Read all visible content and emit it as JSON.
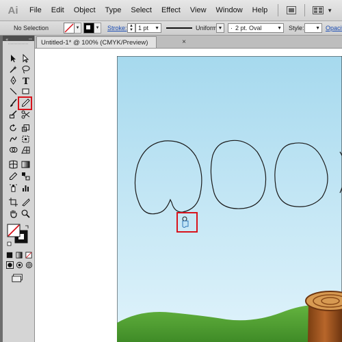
{
  "app": {
    "logo_text": "Ai",
    "menu": [
      "File",
      "Edit",
      "Object",
      "Type",
      "Select",
      "Effect",
      "View",
      "Window",
      "Help"
    ],
    "menu_icons": [
      "bridge-icon",
      "arrange-documents-icon"
    ]
  },
  "control_bar": {
    "selection_label": "No Selection",
    "stroke_label": "Stroke:",
    "stroke_weight": "1 pt",
    "stroke_profile": "Uniform",
    "brush_definition": "2 pt. Oval",
    "style_label": "Style:",
    "opacity_label": "Opacit"
  },
  "document": {
    "tab_title": "Untitled-1* @ 100% (CMYK/Preview)",
    "close_glyph": "×"
  },
  "toolbox": {
    "active_tool": "paintbrush-tool",
    "tools": [
      "selection-tool",
      "direct-selection-tool",
      "magic-wand-tool",
      "lasso-tool",
      "pen-tool",
      "type-tool",
      "line-segment-tool",
      "rectangle-tool",
      "paintbrush-tool",
      "pencil-tool",
      "blob-brush-tool",
      "eraser-tool",
      "rotate-tool",
      "scale-tool",
      "warp-tool",
      "free-transform-tool",
      "shape-builder-tool",
      "perspective-grid-tool",
      "mesh-tool",
      "gradient-tool",
      "eyedropper-tool",
      "blend-tool",
      "symbol-sprayer-tool",
      "column-graph-tool",
      "artboard-tool",
      "slice-tool",
      "hand-tool",
      "zoom-tool"
    ]
  },
  "colors": {
    "highlight": "#d8121b",
    "sky_top": "#a6d9ee",
    "sky_bottom": "#dff2fa",
    "grass": "#5aa838"
  }
}
